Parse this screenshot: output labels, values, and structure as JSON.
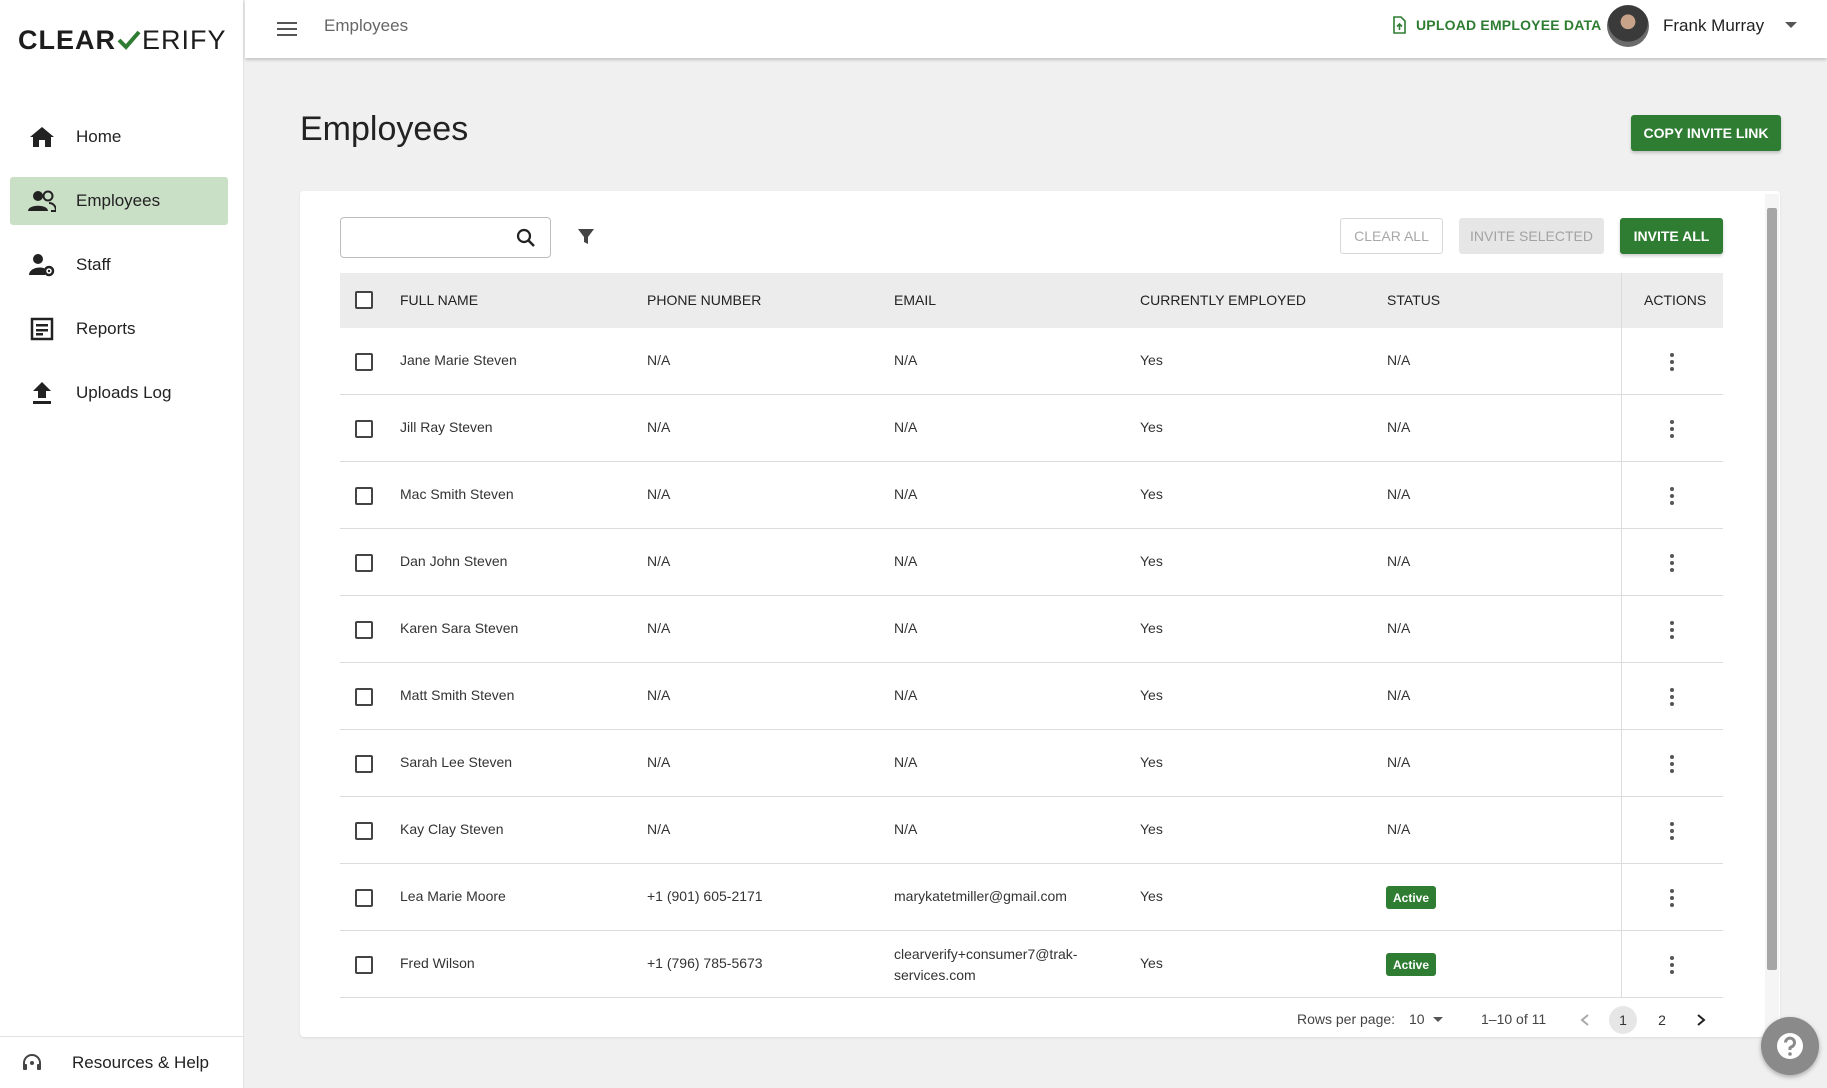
{
  "logo": {
    "left": "CLEAR",
    "right": "ERIFY"
  },
  "sidebar": {
    "items": [
      {
        "label": "Home",
        "icon": "home-icon"
      },
      {
        "label": "Employees",
        "icon": "people-icon",
        "active": true
      },
      {
        "label": "Staff",
        "icon": "staff-settings-icon"
      },
      {
        "label": "Reports",
        "icon": "report-icon"
      },
      {
        "label": "Uploads Log",
        "icon": "upload-icon"
      }
    ],
    "footer": {
      "label": "Resources & Help",
      "icon": "support-icon"
    }
  },
  "topbar": {
    "title": "Employees",
    "upload_label": "UPLOAD EMPLOYEE DATA",
    "user_name": "Frank Murray"
  },
  "page": {
    "title": "Employees",
    "copy_invite_label": "COPY INVITE LINK"
  },
  "toolbar": {
    "search_placeholder": "",
    "clear_all": "CLEAR ALL",
    "invite_selected": "INVITE SELECTED",
    "invite_all": "INVITE ALL"
  },
  "table": {
    "headers": {
      "name": "FULL NAME",
      "phone": "PHONE NUMBER",
      "email": "EMAIL",
      "employed": "CURRENTLY EMPLOYED",
      "status": "STATUS",
      "actions": "ACTIONS"
    },
    "rows": [
      {
        "name": "Jane Marie Steven",
        "phone": "N/A",
        "email": "N/A",
        "employed": "Yes",
        "status": "N/A"
      },
      {
        "name": "Jill Ray Steven",
        "phone": "N/A",
        "email": "N/A",
        "employed": "Yes",
        "status": "N/A"
      },
      {
        "name": "Mac Smith Steven",
        "phone": "N/A",
        "email": "N/A",
        "employed": "Yes",
        "status": "N/A"
      },
      {
        "name": "Dan John Steven",
        "phone": "N/A",
        "email": "N/A",
        "employed": "Yes",
        "status": "N/A"
      },
      {
        "name": "Karen Sara Steven",
        "phone": "N/A",
        "email": "N/A",
        "employed": "Yes",
        "status": "N/A"
      },
      {
        "name": "Matt Smith Steven",
        "phone": "N/A",
        "email": "N/A",
        "employed": "Yes",
        "status": "N/A"
      },
      {
        "name": "Sarah Lee Steven",
        "phone": "N/A",
        "email": "N/A",
        "employed": "Yes",
        "status": "N/A"
      },
      {
        "name": "Kay Clay Steven",
        "phone": "N/A",
        "email": "N/A",
        "employed": "Yes",
        "status": "N/A"
      },
      {
        "name": "Lea Marie Moore",
        "phone": "+1 (901) 605-2171",
        "email": "marykatetmiller@gmail.com",
        "employed": "Yes",
        "status": "Active"
      },
      {
        "name": "Fred Wilson",
        "phone": "+1 (796) 785-5673",
        "email": "clearverify+consumer7@trak-",
        "email_line2": "services.com",
        "employed": "Yes",
        "status": "Active"
      }
    ]
  },
  "pagination": {
    "rows_per_page_label": "Rows per page:",
    "rows_per_page": "10",
    "range": "1–10 of 11",
    "pages": [
      "1",
      "2"
    ],
    "current_page": "1"
  },
  "colors": {
    "primary": "#2e7d32",
    "active_nav_bg": "#c9dfc6",
    "page_bg": "#f0f0f0"
  }
}
